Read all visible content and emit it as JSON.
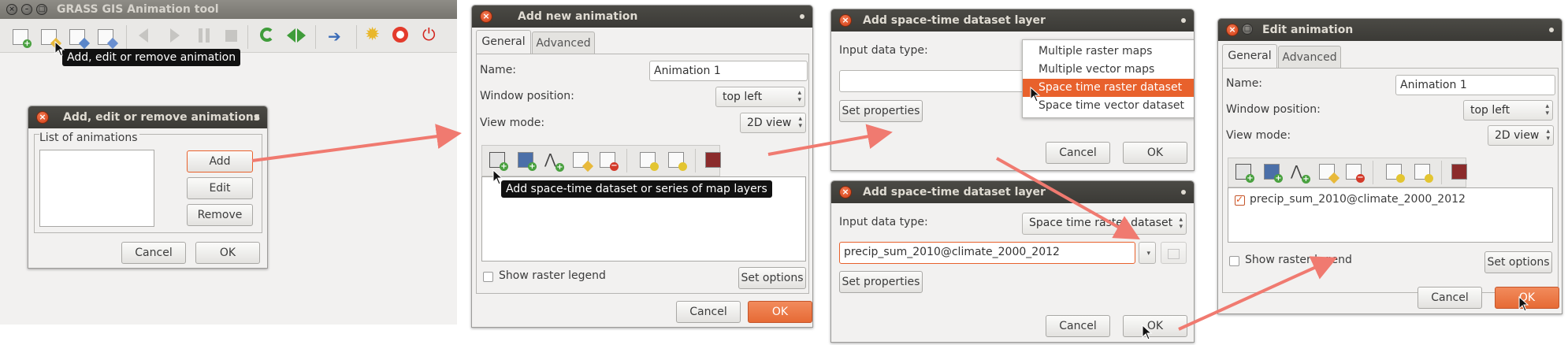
{
  "main_window": {
    "title": "GRASS GIS Animation tool",
    "toolbar_icons": [
      "add-animation-icon",
      "edit-animation-icon",
      "add-edit-animation-icon",
      "remove-animation-icon",
      "step-back-icon",
      "play-icon",
      "pause-icon",
      "stop-icon",
      "loop-icon",
      "bounce-icon",
      "export-icon",
      "settings-icon",
      "help-icon",
      "quit-icon"
    ],
    "tooltip": "Add, edit or remove animation"
  },
  "add_edit_remove": {
    "title": "Add, edit or remove animations",
    "group_label": "List of animations",
    "add_label": "Add",
    "edit_label": "Edit",
    "remove_label": "Remove",
    "cancel_label": "Cancel",
    "ok_label": "OK"
  },
  "add_new_animation": {
    "title": "Add new animation",
    "tab_general": "General",
    "tab_advanced": "Advanced",
    "name_label": "Name:",
    "name_value": "Animation 1",
    "window_position_label": "Window position:",
    "window_position_value": "top left",
    "view_mode_label": "View mode:",
    "view_mode_value": "2D view",
    "tooltip": "Add space-time dataset or series of map layers",
    "show_legend_label": "Show raster legend",
    "set_options_label": "Set options",
    "cancel_label": "Cancel",
    "ok_label": "OK"
  },
  "stds_layer_1": {
    "title": "Add space-time dataset layer",
    "input_type_label": "Input data type:",
    "input_value": "",
    "set_properties_label": "Set properties",
    "cancel_label": "Cancel",
    "ok_label": "OK",
    "dropdown_options": [
      "Multiple raster maps",
      "Multiple vector maps",
      "Space time raster dataset",
      "Space time vector dataset"
    ],
    "selected_option": "Space time raster dataset"
  },
  "stds_layer_2": {
    "title": "Add space-time dataset layer",
    "input_type_label": "Input data type:",
    "input_type_value": "Space time raster dataset",
    "input_value": "precip_sum_2010@climate_2000_2012",
    "set_properties_label": "Set properties",
    "cancel_label": "Cancel",
    "ok_label": "OK"
  },
  "edit_animation": {
    "title": "Edit animation",
    "tab_general": "General",
    "tab_advanced": "Advanced",
    "name_label": "Name:",
    "name_value": "Animation 1",
    "window_position_label": "Window position:",
    "window_position_value": "top left",
    "view_mode_label": "View mode:",
    "view_mode_value": "2D view",
    "layer_item": "precip_sum_2010@climate_2000_2012",
    "show_legend_label": "Show raster legend",
    "set_options_label": "Set options",
    "cancel_label": "Cancel",
    "ok_label": "OK"
  },
  "colors": {
    "accent": "#e8612c",
    "titlebar": "#3c3b37",
    "arrow": "#f07a70",
    "window_bg": "#f2f1f0"
  }
}
